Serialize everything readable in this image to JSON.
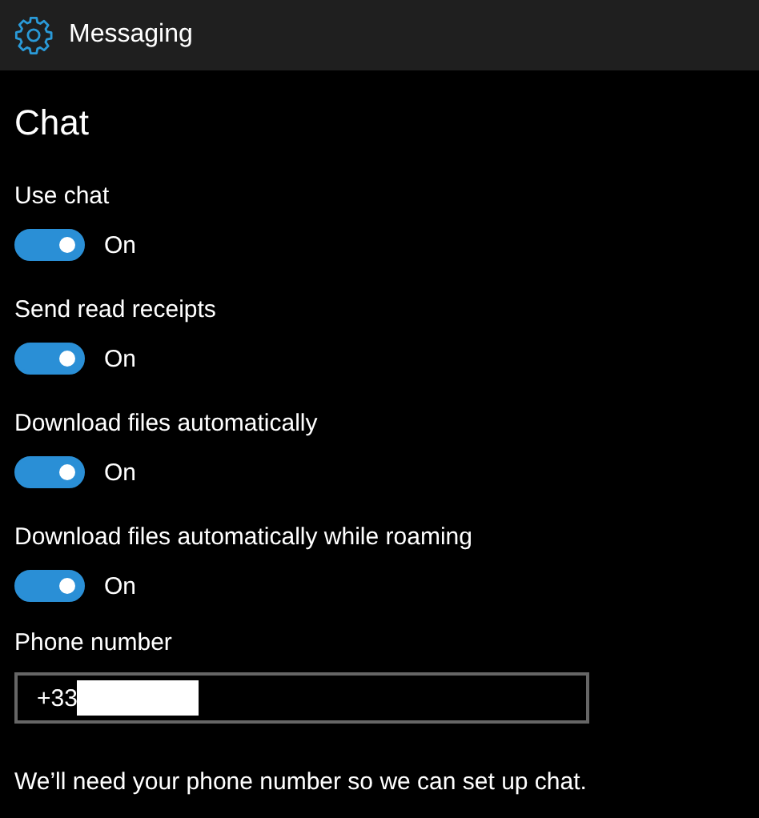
{
  "header": {
    "title": "Messaging"
  },
  "section_title": "Chat",
  "settings": [
    {
      "label": "Use chat",
      "on": true,
      "state_text": "On"
    },
    {
      "label": "Send read receipts",
      "on": true,
      "state_text": "On"
    },
    {
      "label": "Download files automatically",
      "on": true,
      "state_text": "On"
    },
    {
      "label": "Download files automatically while roaming",
      "on": true,
      "state_text": "On"
    }
  ],
  "phone": {
    "label": "Phone number",
    "value": "+33",
    "redacted": true
  },
  "note": "We’ll need your phone number so we can set up chat."
}
